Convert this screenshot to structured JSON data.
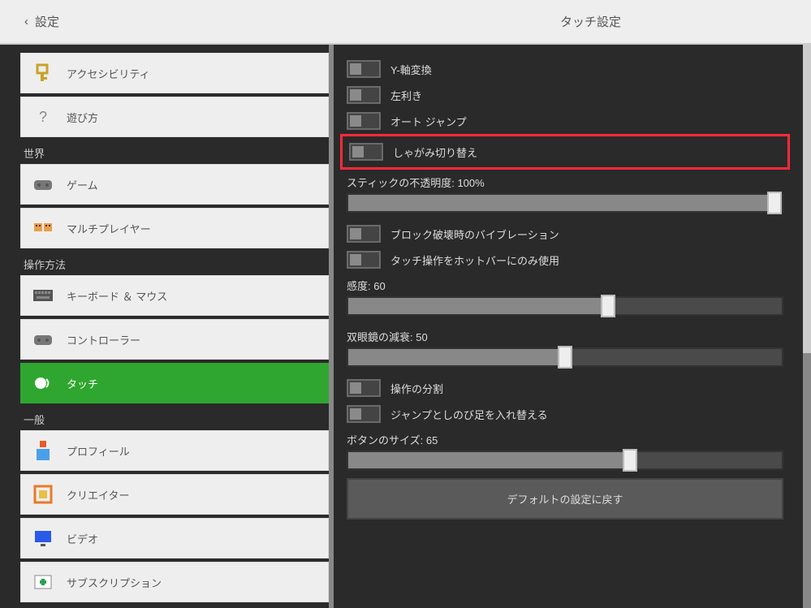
{
  "header": {
    "back_label": "設定",
    "title": "タッチ設定"
  },
  "sidebar": {
    "sections": [
      {
        "items": [
          {
            "icon": "key",
            "label": "アクセシビリティ"
          },
          {
            "icon": "question",
            "label": "遊び方"
          }
        ]
      },
      {
        "label": "世界",
        "items": [
          {
            "icon": "controller-gray",
            "label": "ゲーム"
          },
          {
            "icon": "multiplayer",
            "label": "マルチプレイヤー"
          }
        ]
      },
      {
        "label": "操作方法",
        "items": [
          {
            "icon": "keyboard",
            "label": "キーボード ＆ マウス"
          },
          {
            "icon": "controller-gray",
            "label": "コントローラー"
          },
          {
            "icon": "touch",
            "label": "タッチ",
            "selected": true
          }
        ]
      },
      {
        "label": "一般",
        "items": [
          {
            "icon": "profile",
            "label": "プロフィール"
          },
          {
            "icon": "creator",
            "label": "クリエイター"
          },
          {
            "icon": "video",
            "label": "ビデオ"
          },
          {
            "icon": "subscription",
            "label": "サブスクリプション"
          }
        ]
      }
    ]
  },
  "settings": {
    "toggles": [
      {
        "id": "y-axis",
        "label": "Y-軸変換",
        "on": false
      },
      {
        "id": "lefty",
        "label": "左利き",
        "on": false
      },
      {
        "id": "auto-jump",
        "label": "オート ジャンプ",
        "on": false
      },
      {
        "id": "crouch-toggle",
        "label": "しゃがみ切り替え",
        "on": false,
        "highlighted": true
      }
    ],
    "stick_opacity": {
      "label": "スティックの不透明度",
      "value": 100,
      "display": "スティックの不透明度: 100%"
    },
    "toggles2": [
      {
        "id": "vibrate",
        "label": "ブロック破壊時のバイブレーション",
        "on": false
      },
      {
        "id": "hotbar-only",
        "label": "タッチ操作をホットバーにのみ使用",
        "on": false
      }
    ],
    "sensitivity": {
      "label": "感度",
      "value": 60,
      "display": "感度: 60"
    },
    "spyglass": {
      "label": "双眼鏡の減衰",
      "value": 50,
      "display": "双眼鏡の減衰: 50"
    },
    "toggles3": [
      {
        "id": "split",
        "label": "操作の分割",
        "on": false
      },
      {
        "id": "swap-jump-sneak",
        "label": "ジャンプとしのび足を入れ替える",
        "on": false
      }
    ],
    "button_size": {
      "label": "ボタンのサイズ",
      "value": 65,
      "display": "ボタンのサイズ: 65"
    },
    "reset_button": "デフォルトの設定に戻す"
  }
}
